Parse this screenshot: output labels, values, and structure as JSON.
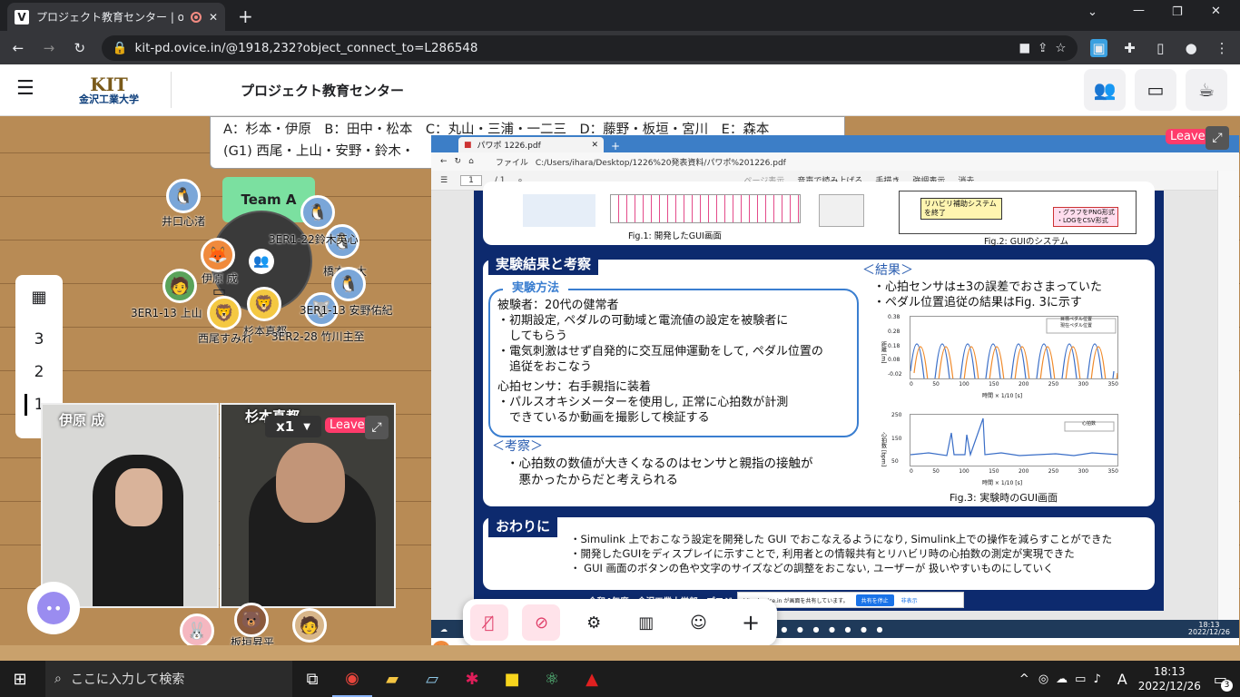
{
  "browser": {
    "tab_title": "プロジェクト教育センター | oVice",
    "url": "kit-pd.ovice.in/@1918,232?object_connect_to=L286548"
  },
  "ovice_header": {
    "logo_main": "KIT",
    "logo_sub": "金沢工業大学",
    "space_title": "プロジェクト教育センター"
  },
  "board": {
    "line1": "A：杉本・伊原　B：田中・松本　C：丸山・三浦・一二三　D：藤野・板垣・宮川　E：森本",
    "line2": "(G1) 西尾・上山・安野・鈴木・"
  },
  "team_label": "Team A",
  "avatar_labels": [
    "井口心渚",
    "3ER1-22鈴木英心",
    "伊原 成",
    "橋本一大",
    "3ER1-13 上山",
    "3ER1-13 安野佑紀",
    "杉本真都",
    "西尾すみれ",
    "3ER2-28 竹川主至",
    "板垣昇平"
  ],
  "floors": {
    "items": [
      "3",
      "2",
      "1"
    ],
    "active": "1"
  },
  "cams": [
    {
      "name": "伊原 成"
    },
    {
      "name": "杉本真都"
    }
  ],
  "cam_zoom": "x1",
  "leave_label": "Leave",
  "share": {
    "edge_tab": "パワポ 1226.pdf",
    "address_prefix": "ファイル",
    "address": "C:/Users/ihara/Desktop/1226%20発表資料/パワポ%201226.pdf",
    "page": "1",
    "pages": "/ 1",
    "toolbar": [
      "ページ表示",
      "音声で読み上げる",
      "手描き",
      "強調表示",
      "消去"
    ],
    "fig1_caption": "Fig.1: 開発したGUI画面",
    "fig2_caption": "Fig.2: GUIのシステム",
    "fig2_box1": "リハビリ補助システムを終了",
    "fig2_box2": "・グラフをPNG形式\n・LOGをCSV形式",
    "results_title": "実験結果と考察",
    "method_title": "実験方法",
    "method_lines": [
      "被験者：20代の健常者",
      "・初期設定, ペダルの可動域と電流値の設定を被験者に",
      "　してもらう",
      "・電気刺激はせず自発的に交互屈伸運動をして, ペダル位置の",
      "　追従をおこなう",
      "心拍センサ：右手親指に装着",
      "・パルスオキシメーターを使用し, 正常に心拍数が計測",
      "　できているか動画を撮影して検証する"
    ],
    "discussion_title": "＜考察＞",
    "discussion_lines": [
      "・心拍数の数値が大きくなるのはセンサと親指の接触が",
      "　悪かったからだと考えられる"
    ],
    "result_title": "＜結果＞",
    "result_lines": [
      "・心拍センサは±3の誤差でおさまっていた",
      "・ペダル位置追従の結果はFig. 3に示す"
    ],
    "fig3_caption": "Fig.3: 実験時のGUI画面",
    "graph1_ylabel": "距離 [m]",
    "graph1_xlabel": "時間 × 1/10 [s]",
    "graph1_legend": [
      "目標ペダル位置",
      "現在ペダル位置"
    ],
    "graph1_yticks": [
      "0.38",
      "0.28",
      "0.18",
      "0.08",
      "-0.02"
    ],
    "graph2_ylabel": "心拍数 [bpm]",
    "graph2_xlabel": "時間 × 1/10 [s]",
    "graph2_legend": [
      "心拍数"
    ],
    "graph2_yticks": [
      "250",
      "150",
      "50"
    ],
    "xticks": [
      "0",
      "50",
      "100",
      "150",
      "200",
      "250",
      "300",
      "350"
    ],
    "end_title": "おわりに",
    "end_lines": [
      "・Simulink 上でおこなう設定を開発した GUI でおこなえるようになり, Simulink上での操作を減らすことができた",
      "・開発したGUIをディスプレイに示すことで, 利用者との情報共有とリハビリ時の心拍数の測定が実現できた",
      "・ GUI 画面のボタンの色や文字のサイズなどの調整をおこない, ユーザーが 扱いやすいものにしていく"
    ],
    "footer": "令和4年度　金沢工業大学部　プロジェクト（ポスター発表会）2022/08/04",
    "share_notice": "kit-pd.ovice.in が画面を共有しています。",
    "share_stop": "共有を停止",
    "share_hide": "非表示",
    "inner_clock_time": "18:13",
    "inner_clock_date": "2022/12/26"
  },
  "presenter_label": "伊原 成",
  "taskbar": {
    "search_placeholder": "ここに入力して検索",
    "time": "18:13",
    "date": "2022/12/26",
    "ime": "A",
    "notif_count": "3"
  }
}
